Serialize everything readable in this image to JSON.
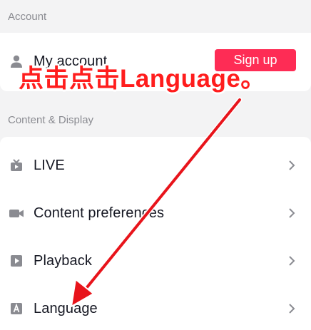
{
  "sections": {
    "account": {
      "title": "Account"
    },
    "content_display": {
      "title": "Content & Display"
    }
  },
  "account_row": {
    "label": "My account",
    "signup_label": "Sign up",
    "icon": "person-icon"
  },
  "menu_items": [
    {
      "label": "LIVE",
      "icon": "live-tv-icon"
    },
    {
      "label": "Content preferences",
      "icon": "video-camera-icon"
    },
    {
      "label": "Playback",
      "icon": "play-square-icon"
    },
    {
      "label": "Language",
      "icon": "letter-a-icon"
    }
  ],
  "annotation": {
    "text": "点击点击Language。",
    "color": "#ff1d1d"
  },
  "colors": {
    "accent": "#fe2c55",
    "background": "#f3f3f4",
    "text_primary": "#161823",
    "text_secondary": "#8a8b91"
  }
}
